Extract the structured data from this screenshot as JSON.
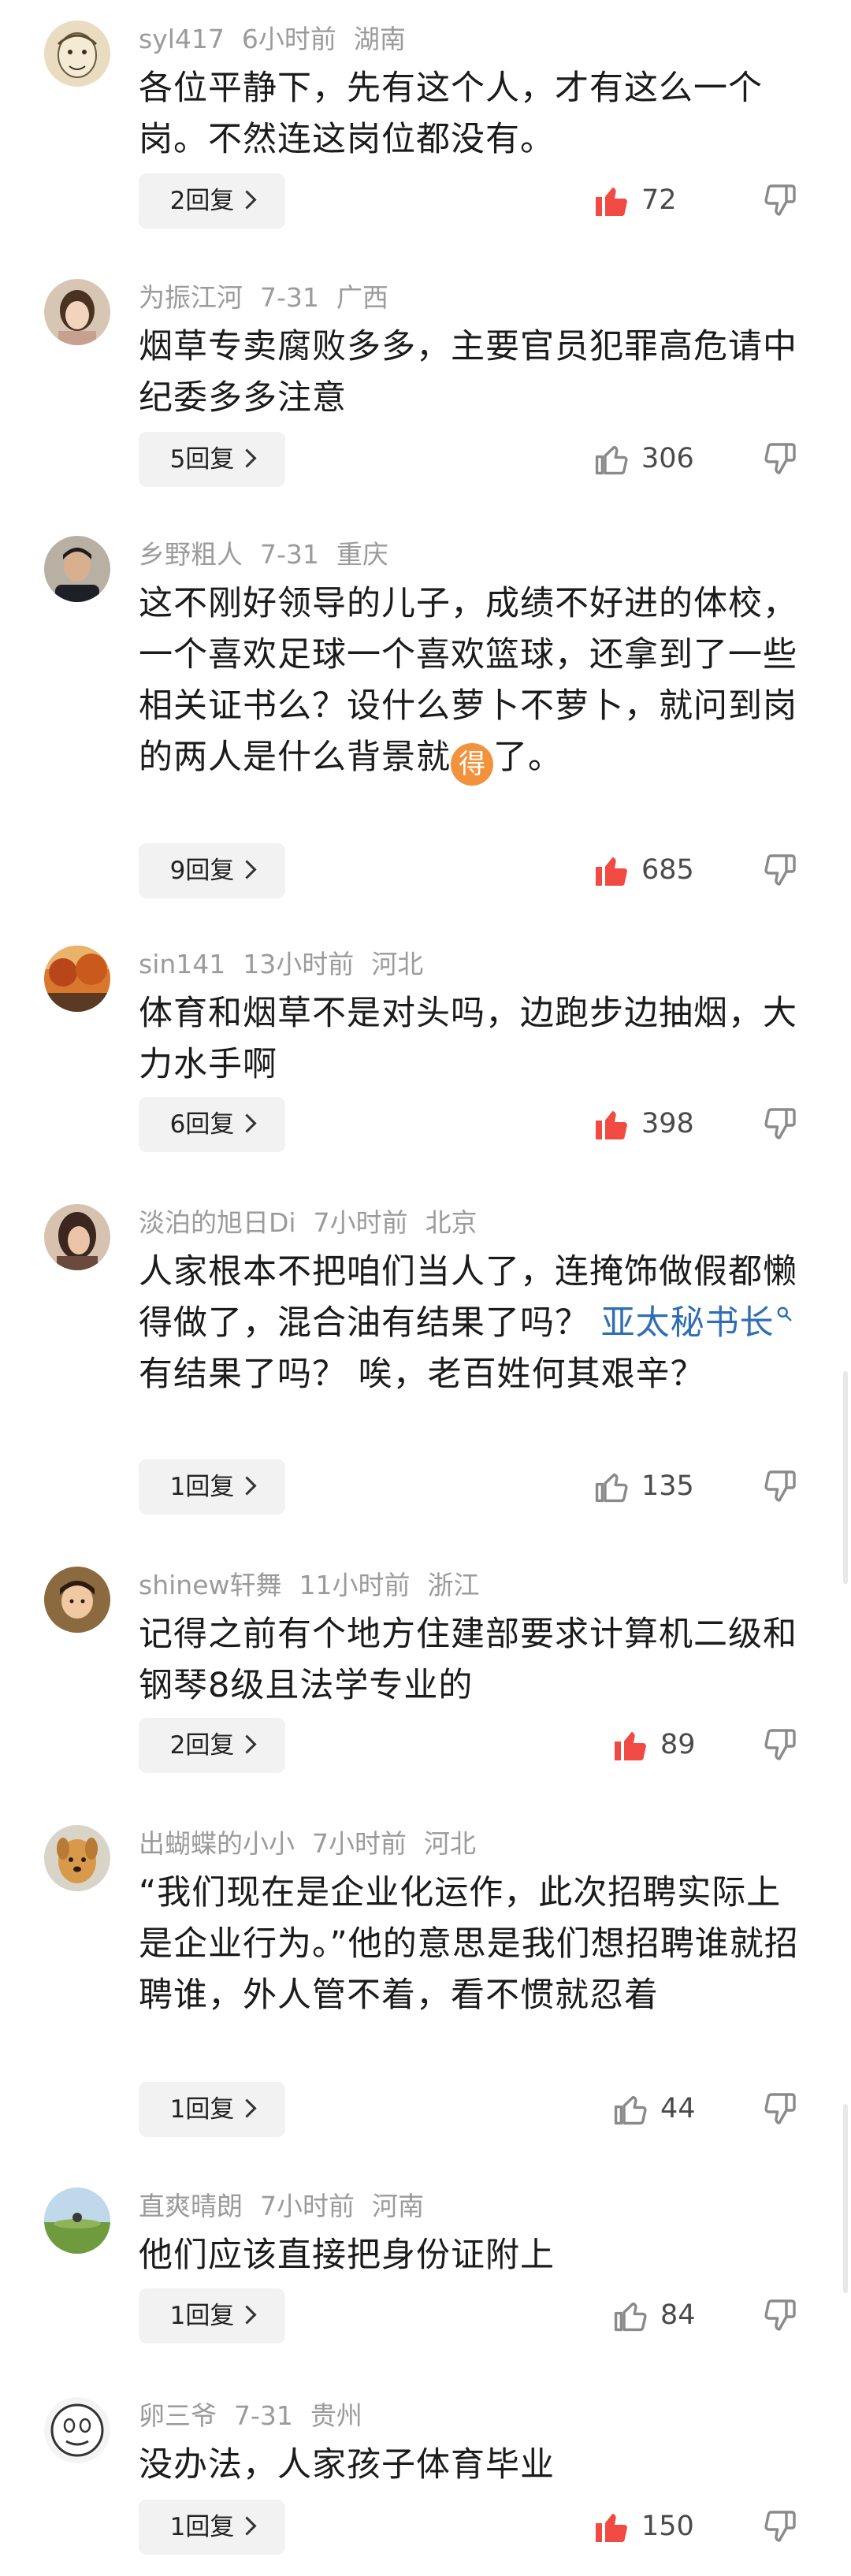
{
  "colors": {
    "like_active": "#f04a42",
    "icon_gray": "#8a8a8a",
    "meta_gray": "#9b9b9b",
    "link_blue": "#2f6eb5",
    "emoji_orange": "#f3923c"
  },
  "comments": [
    {
      "username": "syl417",
      "time": "6小时前",
      "location": "湖南",
      "text": "各位平静下，先有这个人，才有这么一个岗。不然连这岗位都没有。",
      "reply_label": "2回复",
      "likes": "72",
      "liked": true,
      "avatar_icon": "sketch-face-avatar"
    },
    {
      "username": "为振江河",
      "time": "7-31",
      "location": "广西",
      "text": "烟草专卖腐败多多，主要官员犯罪高危请中纪委多多注意",
      "reply_label": "5回复",
      "likes": "306",
      "liked": false,
      "avatar_icon": "girl-photo-avatar"
    },
    {
      "username": "乡野粗人",
      "time": "7-31",
      "location": "重庆",
      "text": "这不刚好领导的儿子，成绩不好进的体校，一个喜欢足球一个喜欢篮球，还拿到了一些相关证书么？设什么萝卜不萝卜，就问到岗的两人是什么背景就",
      "emoji": "得",
      "text_after": "了。",
      "reply_label": "9回复",
      "likes": "685",
      "liked": true,
      "avatar_icon": "man-portrait-avatar"
    },
    {
      "username": "sin141",
      "time": "13小时前",
      "location": "河北",
      "text": "体育和烟草不是对头吗，边跑步边抽烟，大力水手啊",
      "reply_label": "6回复",
      "likes": "398",
      "liked": true,
      "avatar_icon": "autumn-landscape-avatar"
    },
    {
      "username": "淡泊的旭日Di",
      "time": "7小时前",
      "location": "北京",
      "text": "人家根本不把咱们当人了，连掩饰做假都懒得做了，混合油有结果了吗？",
      "link": "亚太秘书长",
      "text_after": "有结果了吗？ 唉，老百姓何其艰辛？",
      "reply_label": "1回复",
      "likes": "135",
      "liked": false,
      "avatar_icon": "woman-portrait-avatar"
    },
    {
      "username": "shinew轩舞",
      "time": "11小时前",
      "location": "浙江",
      "text": "记得之前有个地方住建部要求计算机二级和钢琴8级且法学专业的",
      "reply_label": "2回复",
      "likes": "89",
      "liked": true,
      "avatar_icon": "child-photo-avatar"
    },
    {
      "username": "出蝴蝶的小小",
      "time": "7小时前",
      "location": "河北",
      "text": "“我们现在是企业化运作，此次招聘实际上是企业行为。”他的意思是我们想招聘谁就招聘谁，外人管不着，看不惯就忍着",
      "reply_label": "1回复",
      "likes": "44",
      "liked": false,
      "avatar_icon": "dog-avatar"
    },
    {
      "username": "直爽晴朗",
      "time": "7小时前",
      "location": "河南",
      "text": "他们应该直接把身份证附上",
      "reply_label": "1回复",
      "likes": "84",
      "liked": false,
      "avatar_icon": "field-landscape-avatar"
    },
    {
      "username": "卵三爷",
      "time": "7-31",
      "location": "贵州",
      "text": "没办法，人家孩子体育毕业",
      "reply_label": "1回复",
      "likes": "150",
      "liked": true,
      "avatar_icon": "meme-face-avatar"
    }
  ]
}
